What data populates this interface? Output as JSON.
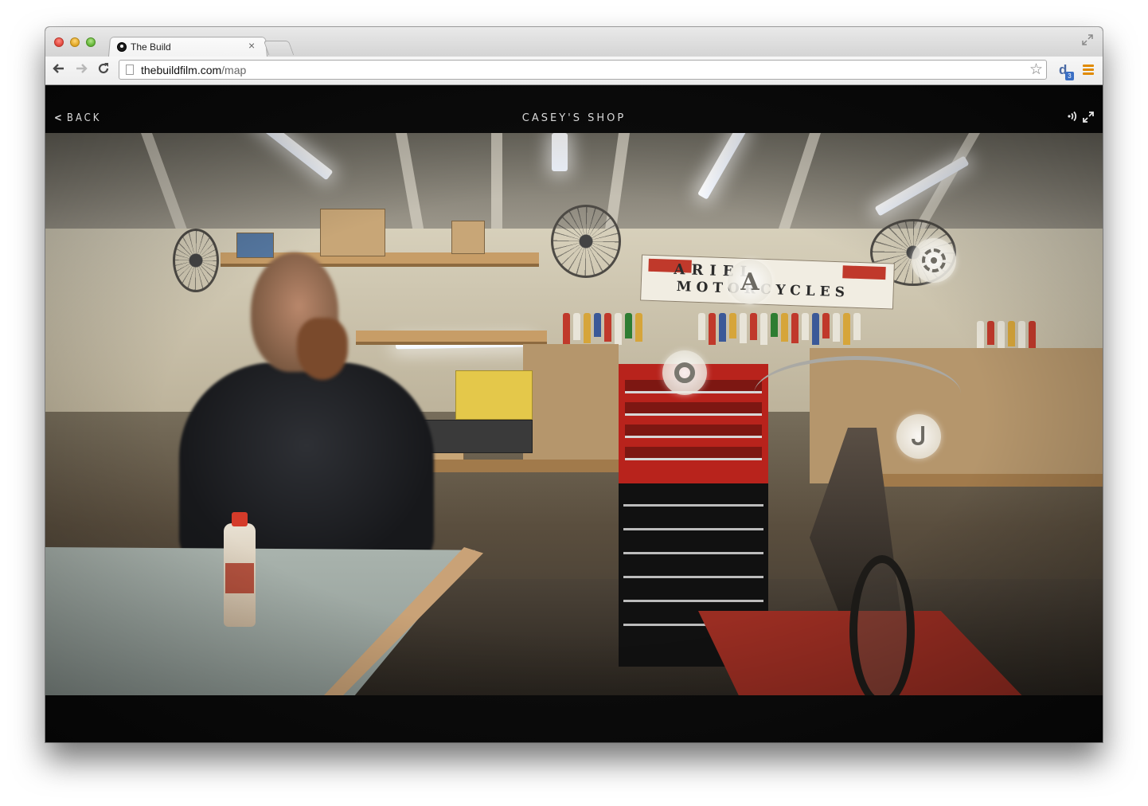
{
  "browser": {
    "tab_title": "The Build",
    "tab_close": "×",
    "url_domain": "thebuildfilm.com",
    "url_path": "/map",
    "extension_badge": "3"
  },
  "page": {
    "back_label": "BACK",
    "title": "CASEY'S SHOP"
  },
  "scene": {
    "sign_line1": "ARIEL",
    "sign_line2": "MOTORCYCLES",
    "hotspots": [
      {
        "name": "hotspot-ariel",
        "icon": "letter-a-icon",
        "glyph": "A"
      },
      {
        "name": "hotspot-wheel",
        "icon": "gear-icon"
      },
      {
        "name": "hotspot-toolbox",
        "icon": "bolt-icon"
      },
      {
        "name": "hotspot-motorcycle",
        "icon": "hook-icon",
        "glyph": "ᒍ"
      }
    ]
  },
  "colors": {
    "page_background": "#000000",
    "header_text": "#d8d8d8",
    "menu_icon": "#e08a00"
  }
}
